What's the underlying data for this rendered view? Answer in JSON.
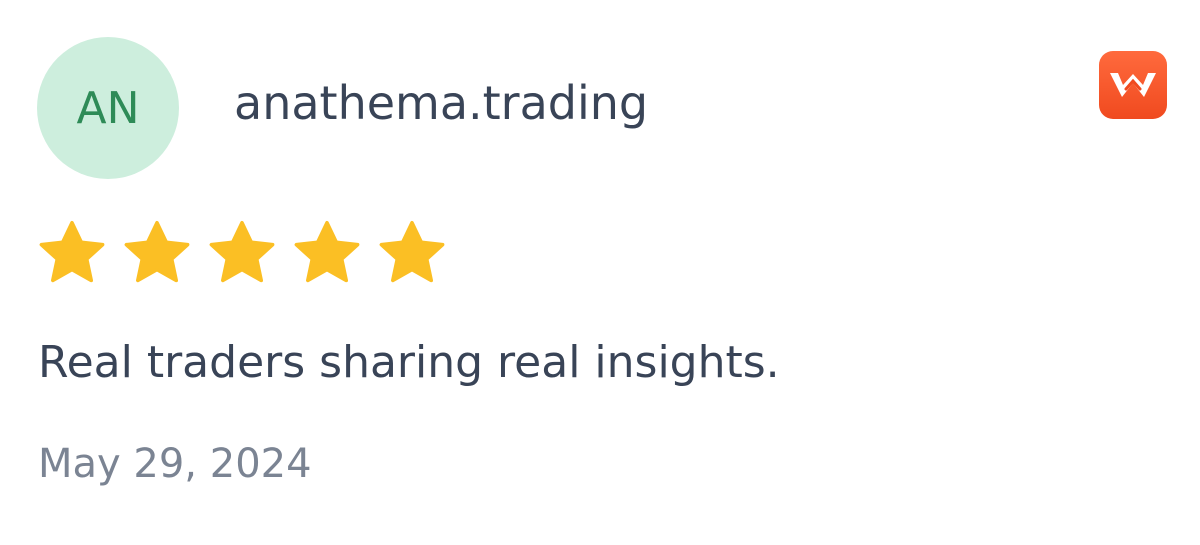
{
  "review": {
    "avatar_initials": "AN",
    "username": "anathema.trading",
    "source_icon": "orange-w-logo-icon",
    "rating": 5,
    "rating_max": 5,
    "text": "Real traders sharing real insights.",
    "date": "May 29, 2024"
  },
  "colors": {
    "avatar_bg": "#cdeedd",
    "avatar_text": "#2e8b57",
    "star": "#fbbf24",
    "badge": "#f0501f",
    "text": "#394457",
    "muted": "#7b8493"
  }
}
